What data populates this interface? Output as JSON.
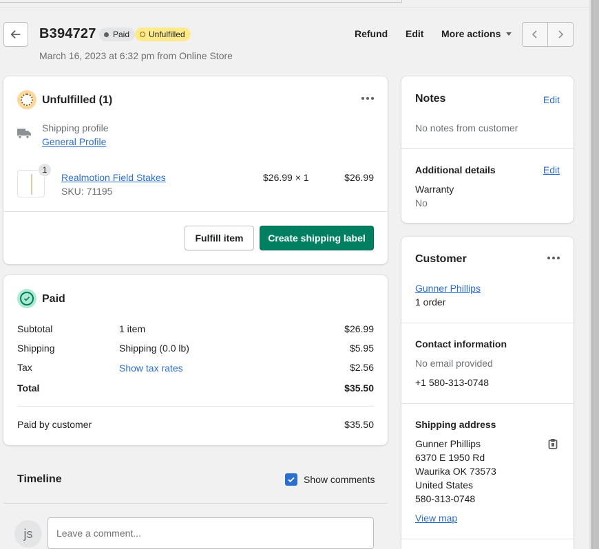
{
  "header": {
    "order_number": "B394727",
    "payment_badge": "Paid",
    "fulfillment_badge": "Unfulfilled",
    "date_line": "March 16, 2023 at 6:32 pm from Online Store",
    "actions": {
      "refund": "Refund",
      "edit": "Edit",
      "more": "More actions"
    }
  },
  "unfulfilled_card": {
    "title": "Unfulfilled (1)",
    "shipping_profile_label": "Shipping profile",
    "shipping_profile_link": "General Profile",
    "line_item": {
      "quantity_badge": "1",
      "name": "Realmotion Field Stakes",
      "sku": "SKU: 71195",
      "price_qty": "$26.99 × 1",
      "total": "$26.99"
    },
    "fulfill_button": "Fulfill item",
    "shipping_label_button": "Create shipping label"
  },
  "paid_card": {
    "title": "Paid",
    "rows": [
      {
        "label": "Subtotal",
        "detail": "1 item",
        "value": "$26.99"
      },
      {
        "label": "Shipping",
        "detail": "Shipping (0.0 lb)",
        "value": "$5.95"
      },
      {
        "label": "Tax",
        "detail": "Show tax rates",
        "value": "$2.56"
      },
      {
        "label": "Total",
        "detail": "",
        "value": "$35.50"
      }
    ],
    "paid_by_label": "Paid by customer",
    "paid_by_value": "$35.50"
  },
  "timeline": {
    "title": "Timeline",
    "show_comments_label": "Show comments",
    "show_comments_checked": true,
    "avatar_initials": "js",
    "comment_placeholder": "Leave a comment..."
  },
  "notes_card": {
    "title": "Notes",
    "edit": "Edit",
    "empty_text": "No notes from customer",
    "additional_title": "Additional details",
    "additional_edit": "Edit",
    "warranty_label": "Warranty",
    "warranty_value": "No"
  },
  "customer_card": {
    "title": "Customer",
    "name_link": "Gunner Phillips",
    "orders": "1 order",
    "contact_title": "Contact information",
    "email": "No email provided",
    "phone": "+1 580-313-0748",
    "shipping_title": "Shipping address",
    "address_lines": [
      "Gunner Phillips",
      "6370 E 1950 Rd",
      "Waurika OK 73573",
      "United States",
      "580-313-0748"
    ],
    "view_map": "View map"
  },
  "colors": {
    "primary_button": "#008060",
    "link": "#2c6ecb",
    "unfulfilled_badge": "#ffea8a",
    "paid_icon_bg": "#aee9d1"
  },
  "icons": [
    "arrow-left-icon",
    "chevron-left-icon",
    "chevron-right-icon",
    "caret-down-icon",
    "unfulfilled-status-icon",
    "paid-status-icon",
    "truck-icon",
    "more-horizontal-icon",
    "checkbox-checked-icon",
    "clipboard-copy-icon"
  ]
}
